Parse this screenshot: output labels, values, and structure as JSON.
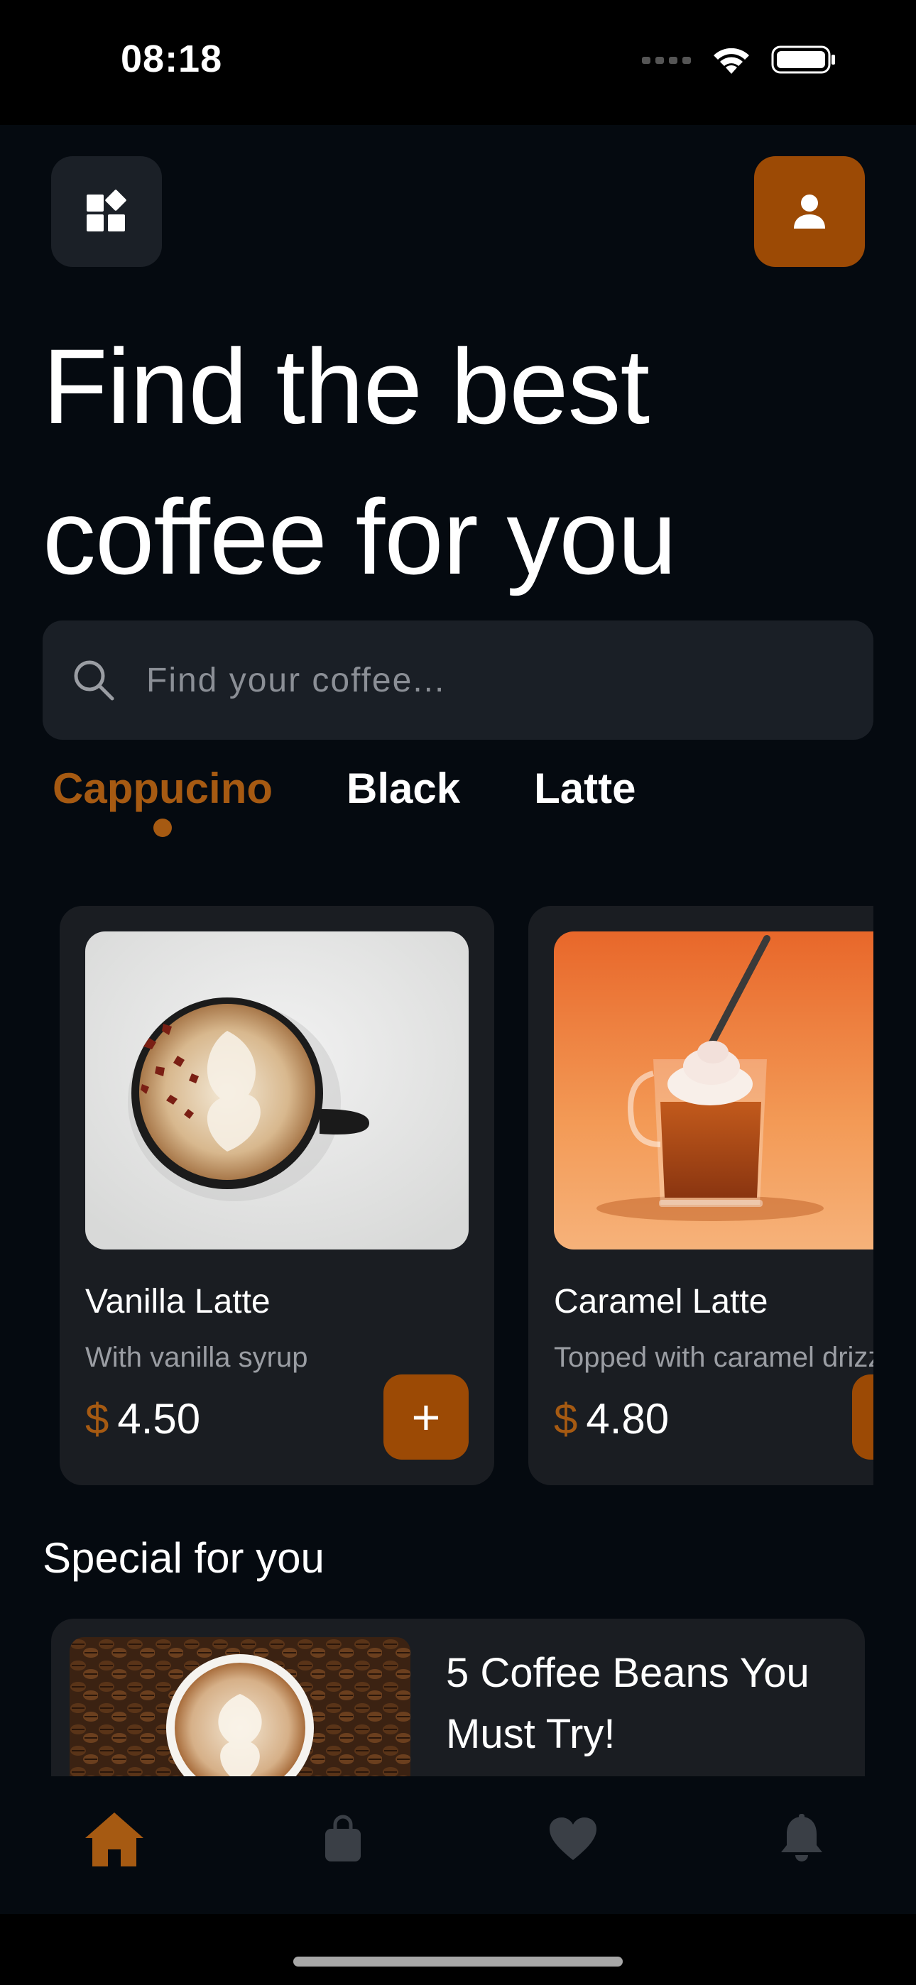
{
  "status_bar": {
    "time": "08:18"
  },
  "header": {
    "headline_line1": "Find the best",
    "headline_line2": "coffee for you"
  },
  "search": {
    "placeholder": "Find your coffee..."
  },
  "tabs": [
    {
      "label": "Cappucino",
      "active": true
    },
    {
      "label": "Black",
      "active": false
    },
    {
      "label": "Latte",
      "active": false
    }
  ],
  "products": [
    {
      "name": "Vanilla Latte",
      "description": "With vanilla syrup",
      "currency": "$",
      "price": "4.50",
      "add_label": "+"
    },
    {
      "name": "Caramel Latte",
      "description": "Topped with caramel drizzle",
      "currency": "$",
      "price": "4.80",
      "add_label": "+"
    }
  ],
  "special": {
    "section_title": "Special for you",
    "article_title": "5 Coffee Beans You Must Try!"
  },
  "bottom_nav": [
    {
      "icon": "home-icon",
      "active": true
    },
    {
      "icon": "bag-icon",
      "active": false
    },
    {
      "icon": "heart-icon",
      "active": false
    },
    {
      "icon": "bell-icon",
      "active": false
    }
  ],
  "colors": {
    "accent": "#9c4a05",
    "accent_text": "#a65a12",
    "background": "#050a10",
    "card": "#1a1d22",
    "inactive_icon": "#3a3f46"
  }
}
